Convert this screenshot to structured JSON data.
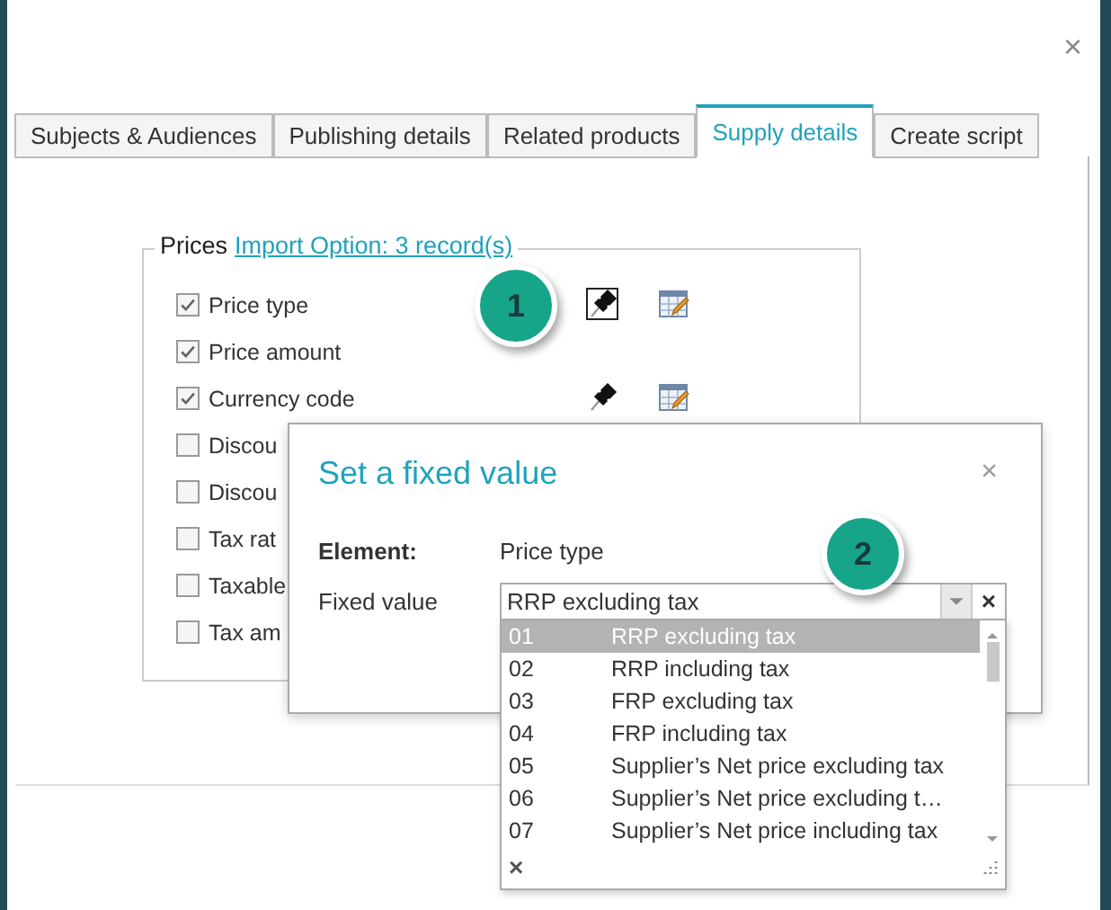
{
  "close_label": "×",
  "tabs": [
    {
      "label": "Subjects & Audiences",
      "selected": false
    },
    {
      "label": "Publishing details",
      "selected": false
    },
    {
      "label": "Related products",
      "selected": false
    },
    {
      "label": "Supply details",
      "selected": true
    },
    {
      "label": "Create script",
      "selected": false
    }
  ],
  "prices": {
    "legend": "Prices",
    "link": "Import Option: 3  record(s)",
    "fields": [
      {
        "label": "Price type",
        "checked": true,
        "actions": true,
        "pin_focused": true
      },
      {
        "label": "Price amount",
        "checked": true,
        "actions": false
      },
      {
        "label": "Currency code",
        "checked": true,
        "actions": true,
        "pin_focused": false
      },
      {
        "label": "Discou",
        "checked": false,
        "actions": false
      },
      {
        "label": "Discou",
        "checked": false,
        "actions": false
      },
      {
        "label": "Tax rat",
        "checked": false,
        "actions": false
      },
      {
        "label": "Taxable",
        "checked": false,
        "actions": false
      },
      {
        "label": "Tax am",
        "checked": false,
        "actions": false
      }
    ]
  },
  "callouts": [
    {
      "number": "1"
    },
    {
      "number": "2"
    }
  ],
  "dialog": {
    "title": "Set a fixed value",
    "close_label": "×",
    "element_label": "Element:",
    "element_value": "Price type",
    "fixed_label": "Fixed value",
    "fixed_value": "RRP excluding tax",
    "clear_label": "×",
    "options": [
      {
        "code": "01",
        "label": "RRP excluding tax",
        "selected": true
      },
      {
        "code": "02",
        "label": "RRP including tax",
        "selected": false
      },
      {
        "code": "03",
        "label": "FRP excluding tax",
        "selected": false
      },
      {
        "code": "04",
        "label": "FRP including tax",
        "selected": false
      },
      {
        "code": "05",
        "label": "Supplier’s Net price excluding tax",
        "selected": false
      },
      {
        "code": "06",
        "label": "Supplier’s Net price excluding t…",
        "selected": false
      },
      {
        "code": "07",
        "label": "Supplier’s Net price including tax",
        "selected": false
      }
    ],
    "list_clear_label": "×"
  }
}
